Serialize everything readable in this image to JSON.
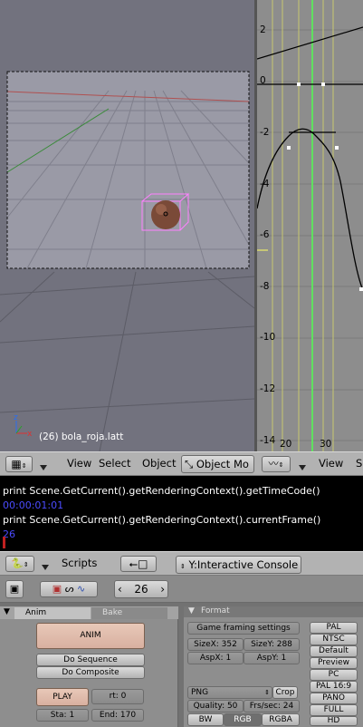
{
  "viewport3d": {
    "object_label": "(26) bola_roja.latt",
    "axis_x": "x",
    "axis_z": "z",
    "menu": {
      "view": "View",
      "select": "Select",
      "object": "Object",
      "mode": "Object Mo"
    }
  },
  "ipo": {
    "y_ticks": [
      "2",
      "0",
      "-2",
      "-4",
      "-6",
      "-8",
      "-10",
      "-12",
      "-14"
    ],
    "x_ticks": [
      "20",
      "30"
    ],
    "menu": {
      "view": "View"
    }
  },
  "console": {
    "lines": [
      {
        "text": "print Scene.GetCurrent().getRenderingContext().getTimeCode()",
        "color": "#ffffff"
      },
      {
        "text": "00:00:01:01",
        "color": "#4b4bff"
      },
      {
        "text": "print Scene.GetCurrent().getRenderingContext().currentFrame()",
        "color": "#ffffff"
      },
      {
        "text": "26",
        "color": "#4b4bff"
      }
    ],
    "header": {
      "scripts": "Scripts",
      "console_name": "Y:Interactive Console"
    }
  },
  "buttons_window": {
    "frame": "26",
    "anim_panel": {
      "tab_anim": "Anim",
      "tab_bake": "Bake",
      "anim_button": "ANIM",
      "do_sequence": "Do Sequence",
      "do_composite": "Do Composite",
      "play": "PLAY",
      "rt": "rt: 0",
      "sta": "Sta: 1",
      "end": "End: 170"
    },
    "format_panel": {
      "title": "Format",
      "game_framing": "Game framing settings",
      "sizex": "SizeX: 352",
      "sizey": "SizeY: 288",
      "aspx": "AspX: 1",
      "aspy": "AspY: 1",
      "file_format": "PNG",
      "crop": "Crop",
      "quality": "Quality: 50",
      "frs": "Frs/sec: 24",
      "bw": "BW",
      "rgb": "RGB",
      "rgba": "RGBA",
      "presets": [
        "PAL",
        "NTSC",
        "Default",
        "Preview",
        "PC",
        "PAL 16:9",
        "PANO",
        "FULL",
        "HD"
      ]
    }
  }
}
